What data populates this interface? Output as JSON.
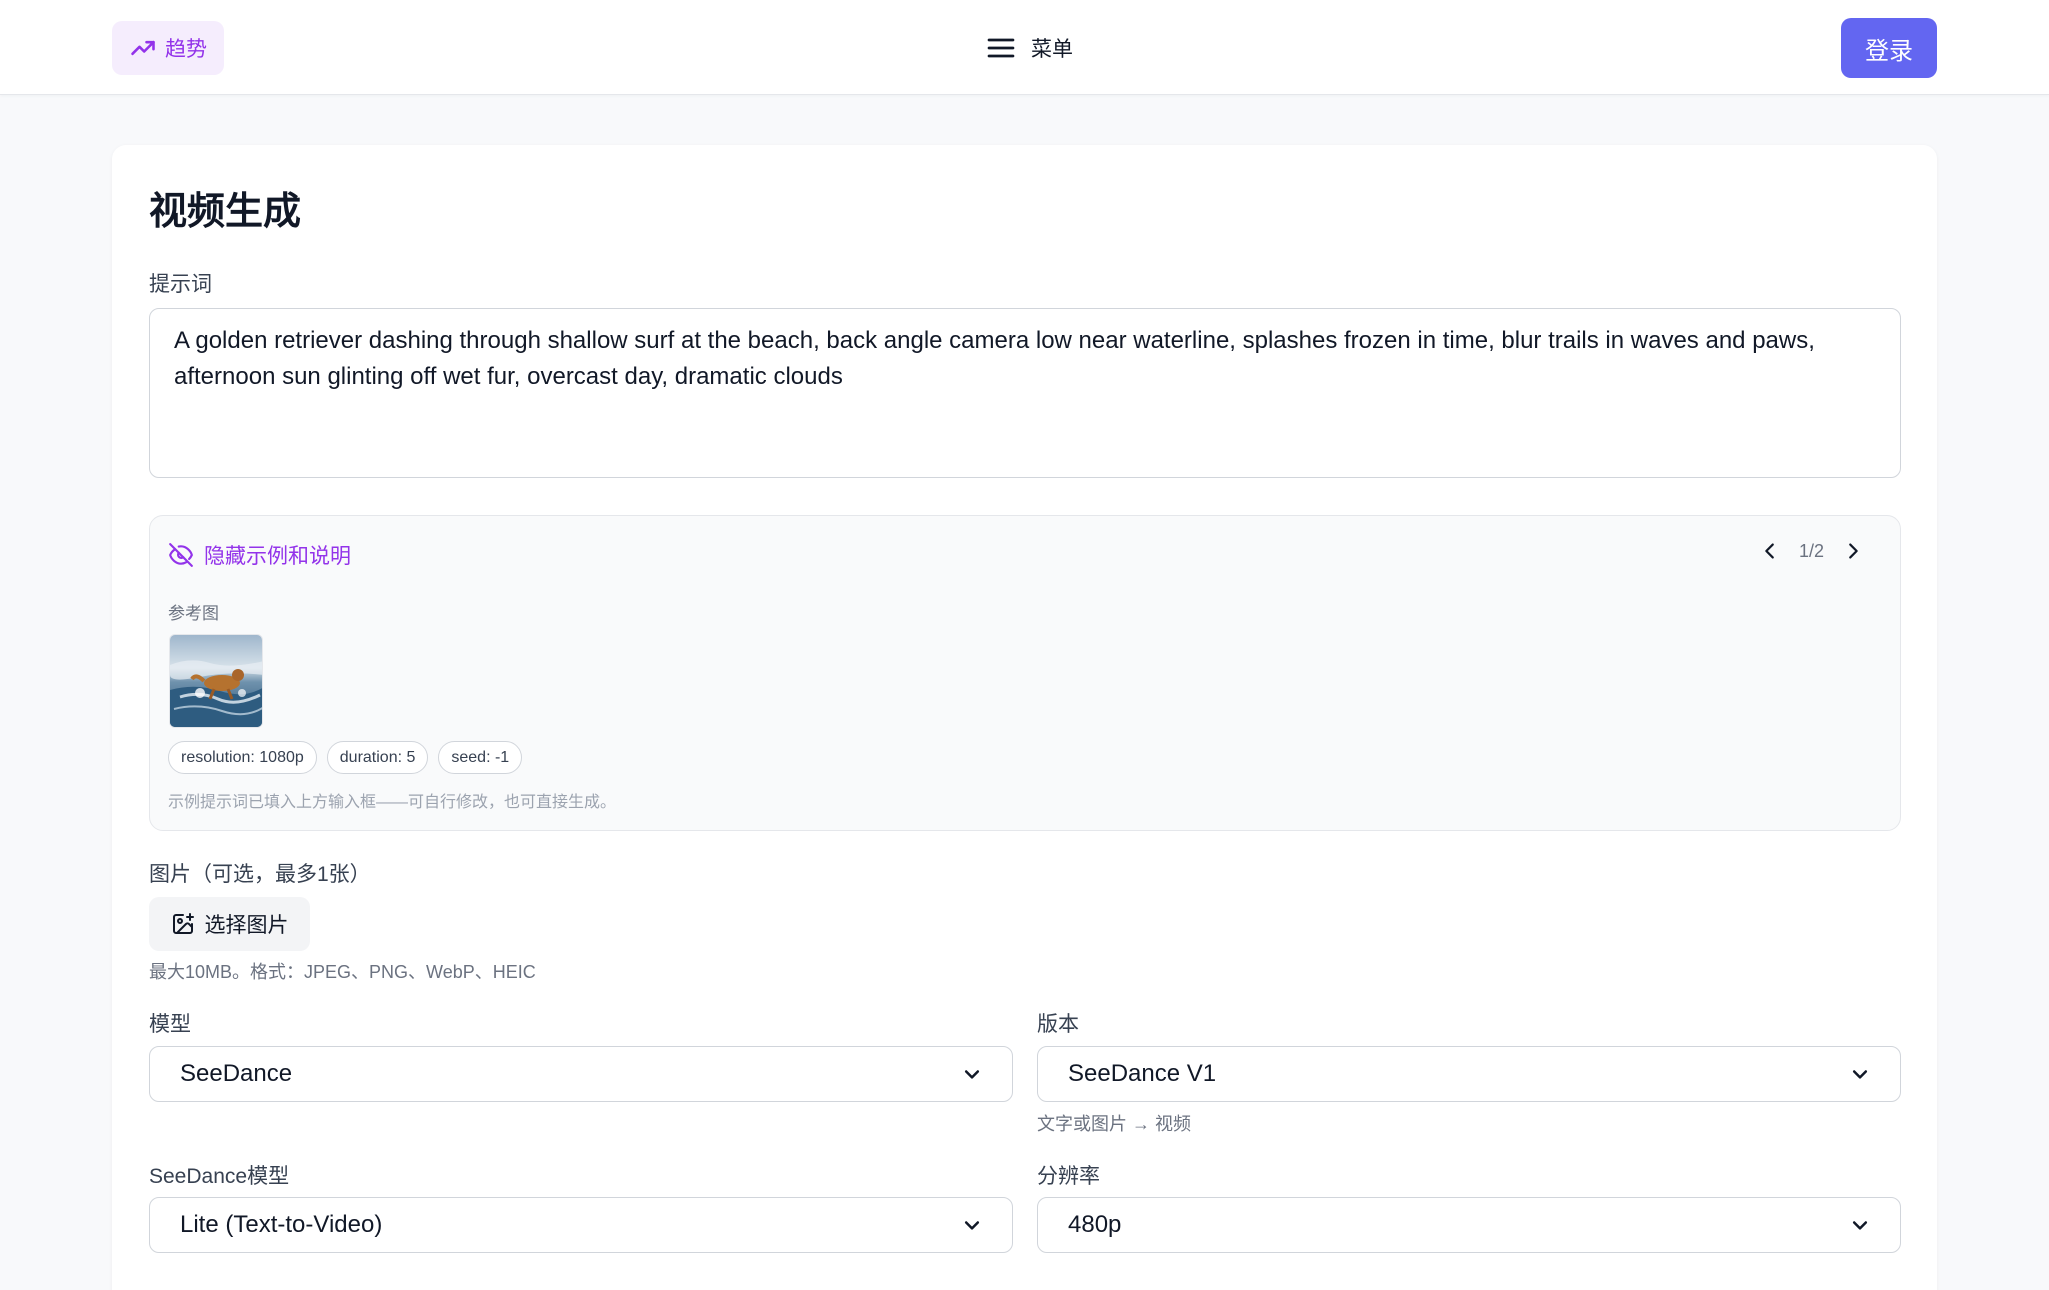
{
  "header": {
    "trend_label": "趋势",
    "menu_label": "菜单",
    "login_label": "登录"
  },
  "page": {
    "title": "视频生成"
  },
  "prompt": {
    "label": "提示词",
    "value": "A golden retriever dashing through shallow surf at the beach, back angle camera low near waterline, splashes frozen in time, blur trails in waves and paws, afternoon sun glinting off wet fur, overcast day, dramatic clouds"
  },
  "examples": {
    "toggle_label": "隐藏示例和说明",
    "page_indicator": "1/2",
    "ref_label": "参考图",
    "chips": [
      "resolution: 1080p",
      "duration: 5",
      "seed: -1"
    ],
    "note": "示例提示词已填入上方输入框——可自行修改，也可直接生成。"
  },
  "image_upload": {
    "label": "图片（可选，最多1张）",
    "button_label": "选择图片",
    "hint": "最大10MB。格式：JPEG、PNG、WebP、HEIC"
  },
  "model": {
    "label": "模型",
    "value": "SeeDance"
  },
  "version": {
    "label": "版本",
    "value": "SeeDance V1",
    "hint": "文字或图片 → 视频"
  },
  "seedance_model": {
    "label": "SeeDance模型",
    "value": "Lite (Text-to-Video)"
  },
  "resolution": {
    "label": "分辨率",
    "value": "480p"
  },
  "colors": {
    "accent": "#6366f1",
    "purple": "#9333ea",
    "background": "#f8f9fb"
  },
  "icons": {
    "trend": "trending-up-icon",
    "menu": "hamburger-menu-icon",
    "hide": "eye-off-icon",
    "prev": "chevron-left-icon",
    "next": "chevron-right-icon",
    "image_add": "image-plus-icon",
    "dropdown": "chevron-down-icon"
  }
}
